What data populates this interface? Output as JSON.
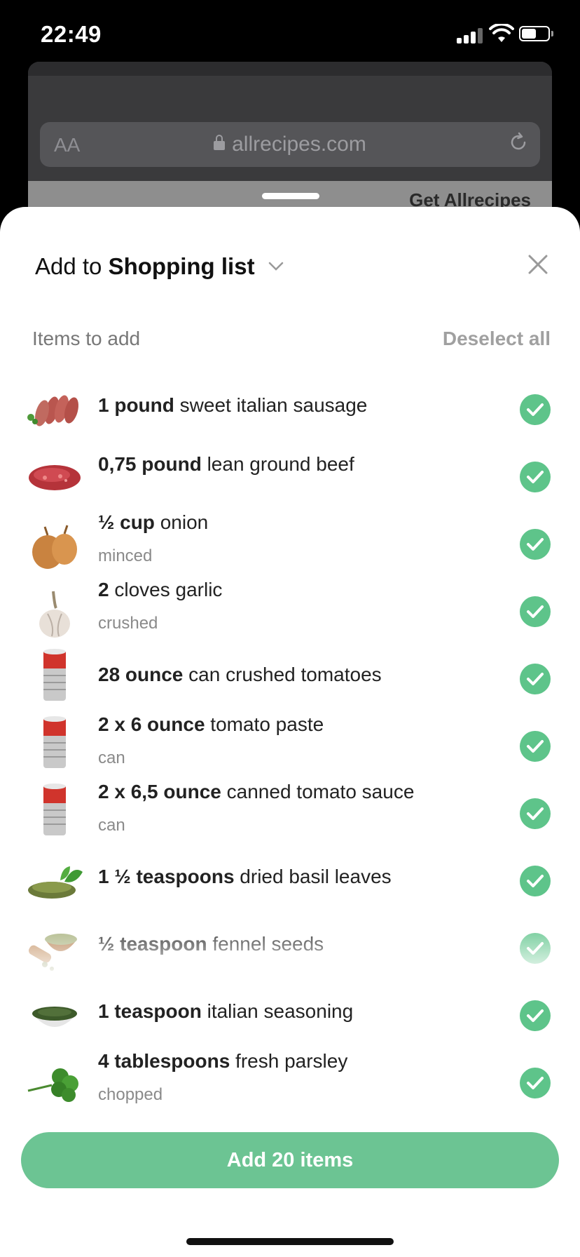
{
  "status_bar": {
    "time": "22:49"
  },
  "browser": {
    "text_size_label": "AA",
    "url": "allrecipes.com",
    "partial_banner_text": "Get Allrecipes"
  },
  "sheet": {
    "title_prefix": "Add to",
    "title_list": "Shopping list",
    "section_label": "Items to add",
    "deselect_all": "Deselect all",
    "items": [
      {
        "qty": "1 pound",
        "name": "sweet italian sausage",
        "note": "",
        "icon": "sausage-icon",
        "checked": true
      },
      {
        "qty": "0,75 pound",
        "name": "lean ground beef",
        "note": "",
        "icon": "ground-beef-icon",
        "checked": true
      },
      {
        "qty": "½ cup",
        "name": "onion",
        "note": "minced",
        "icon": "onion-icon",
        "checked": true
      },
      {
        "qty": "2",
        "name": "cloves garlic",
        "note": "crushed",
        "icon": "garlic-icon",
        "checked": true
      },
      {
        "qty": "28 ounce",
        "name": "can crushed tomatoes",
        "note": "",
        "icon": "tomato-can-icon",
        "checked": true
      },
      {
        "qty": "2 x 6 ounce",
        "name": "tomato paste",
        "note": "can",
        "icon": "tomato-can-icon",
        "checked": true
      },
      {
        "qty": "2 x 6,5 ounce",
        "name": "canned tomato sauce",
        "note": "can",
        "icon": "tomato-can-icon",
        "checked": true
      },
      {
        "qty": "1 ½ teaspoons",
        "name": "dried basil leaves",
        "note": "",
        "icon": "basil-icon",
        "checked": true
      },
      {
        "qty": "½ teaspoon",
        "name": "fennel seeds",
        "note": "",
        "icon": "fennel-seeds-icon",
        "checked": true
      },
      {
        "qty": "1  teaspoon",
        "name": "italian seasoning",
        "note": "",
        "icon": "seasoning-icon",
        "checked": true
      },
      {
        "qty": "4  tablespoons",
        "name": "fresh parsley",
        "note": "chopped",
        "icon": "parsley-icon",
        "checked": true
      }
    ],
    "add_button_label": "Add 20 items"
  }
}
